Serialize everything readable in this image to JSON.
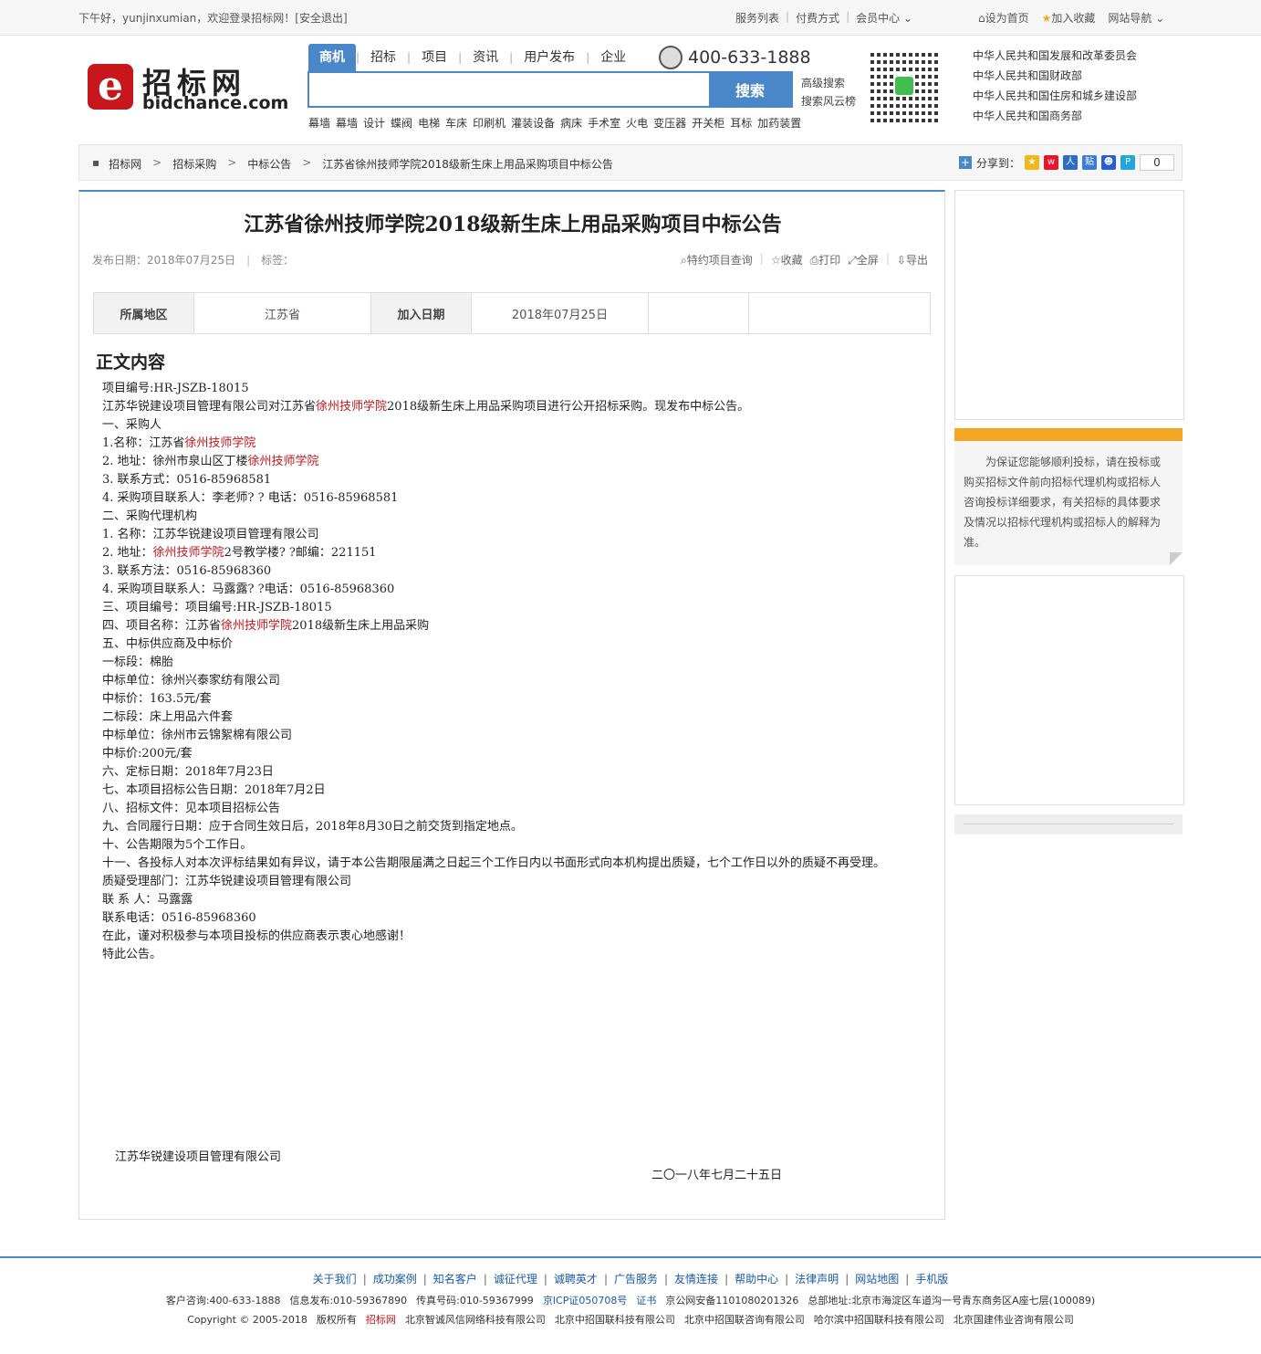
{
  "topbar": {
    "greeting": "下午好，yunjinxumian，欢迎登录招标网！[安全退出]",
    "links": [
      "服务列表",
      "付费方式",
      "会员中心"
    ],
    "set_home": "设为首页",
    "add_fav": "加入收藏",
    "site_nav": "网站导航"
  },
  "logo": {
    "cn": "招标网",
    "en": "bidchance.com"
  },
  "nav": {
    "tabs": [
      "商机",
      "招标",
      "项目",
      "资讯",
      "用户发布",
      "企业"
    ],
    "phone": "400-633-1888"
  },
  "search": {
    "button": "搜索",
    "adv": "高级搜索",
    "cloud": "搜索风云榜"
  },
  "hotwords": [
    "幕墙",
    "幕墙",
    "设计",
    "蝶阀",
    "电梯",
    "车床",
    "印刷机",
    "灌装设备",
    "病床",
    "手术室",
    "火电",
    "变压器",
    "开关柜",
    "耳标",
    "加药装置"
  ],
  "gov": [
    "中华人民共和国发展和改革委员会",
    "中华人民共和国财政部",
    "中华人民共和国住房和城乡建设部",
    "中华人民共和国商务部"
  ],
  "crumb": [
    "招标网",
    "招标采购",
    "中标公告",
    "江苏省徐州技师学院2018级新生床上用品采购项目中标公告"
  ],
  "share": {
    "label": "分享到：",
    "count": "0"
  },
  "article": {
    "title": "江苏省徐州技师学院2018级新生床上用品采购项目中标公告",
    "publish": "发布日期：2018年07月25日",
    "tags": "标签：",
    "tools": [
      "特约项目查询",
      "收藏",
      "打印",
      "全屏",
      "导出"
    ],
    "info": {
      "region_label": "所属地区",
      "region": "江苏省",
      "date_label": "加入日期",
      "date": "2018年07月25日"
    },
    "section": "正文内容",
    "sign_org": "江苏华锐建设项目管理有限公司",
    "sign_date": "二〇一八年七月二十五日"
  },
  "body_lines": [
    [
      "项目编号:HR-JSZB-18015"
    ],
    [
      "江苏华锐建设项目管理有限公司对江苏省",
      "#徐州技师学院",
      "2018级新生床上用品采购项目进行公开招标采购。现发布中标公告。"
    ],
    [
      "一、采购人"
    ],
    [
      "1.名称：江苏省",
      "#徐州技师学院"
    ],
    [
      "2. 地址：徐州市泉山区丁楼",
      "#徐州技师学院"
    ],
    [
      "3. 联系方式：0516-85968581"
    ],
    [
      "4. 采购项目联系人：李老师? ? 电话：0516-85968581"
    ],
    [
      "二、采购代理机构"
    ],
    [
      "1. 名称：江苏华锐建设项目管理有限公司"
    ],
    [
      "2. 地址：",
      "#徐州技师学院",
      "2号教学楼? ?邮编：221151"
    ],
    [
      "3. 联系方法：0516-85968360"
    ],
    [
      "4. 采购项目联系人：马露露? ?电话：0516-85968360"
    ],
    [
      "三、项目编号：项目编号:HR-JSZB-18015"
    ],
    [
      "四、项目名称：江苏省",
      "#徐州技师学院",
      "2018级新生床上用品采购"
    ],
    [
      "五、中标供应商及中标价"
    ],
    [
      "一标段：棉胎"
    ],
    [
      "中标单位：徐州兴泰家纺有限公司"
    ],
    [
      "中标价：163.5元/套"
    ],
    [
      "二标段：床上用品六件套"
    ],
    [
      "中标单位：徐州市云锦絮棉有限公司"
    ],
    [
      "中标价:200元/套"
    ],
    [
      "六、定标日期：2018年7月23日"
    ],
    [
      "七、本项目招标公告日期：2018年7月2日"
    ],
    [
      "八、招标文件：见本项目招标公告"
    ],
    [
      "九、合同履行日期：应于合同生效日后，2018年8月30日之前交货到指定地点。"
    ],
    [
      "十、公告期限为5个工作日。"
    ],
    [
      "十一、各投标人对本次评标结果如有异议，请于本公告期限届满之日起三个工作日内以书面形式向本机构提出质疑，七个工作日以外的质疑不再受理。"
    ],
    [
      "质疑受理部门：江苏华锐建设项目管理有限公司"
    ],
    [
      "联 系 人：马露露"
    ],
    [
      "联系电话：0516-85968360"
    ],
    [
      "在此，谨对积极参与本项目投标的供应商表示衷心地感谢！"
    ],
    [
      "特此公告。"
    ]
  ],
  "notice": "为保证您能够顺利投标，请在投标或购买招标文件前向招标代理机构或招标人咨询投标详细要求，有关招标的具体要求及情况以招标代理机构或招标人的解释为准。",
  "footer": {
    "links": [
      "关于我们",
      "成功案例",
      "知名客户",
      "诚征代理",
      "诚聘英才",
      "广告服务",
      "友情连接",
      "帮助中心",
      "法律声明",
      "网站地图",
      "手机版"
    ],
    "info": [
      "客户咨询:400-633-1888",
      "信息发布:010-59367890",
      "传真号码:010-59367999",
      "京ICP证050708号",
      "证书",
      "京公网安备1101080201326",
      "总部地址:北京市海淀区车道沟一号青东商务区A座七层(100089)"
    ],
    "copy": [
      "Copyright © 2005-2018",
      "版权所有",
      "招标网",
      "北京智诚风信网络科技有限公司",
      "北京中招国联科技有限公司",
      "北京中招国联咨询有限公司",
      "哈尔滨中招国联科技有限公司",
      "北京国建伟业咨询有限公司"
    ]
  },
  "colors": {
    "accent": "#4a87c9",
    "brand": "#c8161d",
    "highlight": "#c0151b",
    "notice": "#f5a623"
  }
}
